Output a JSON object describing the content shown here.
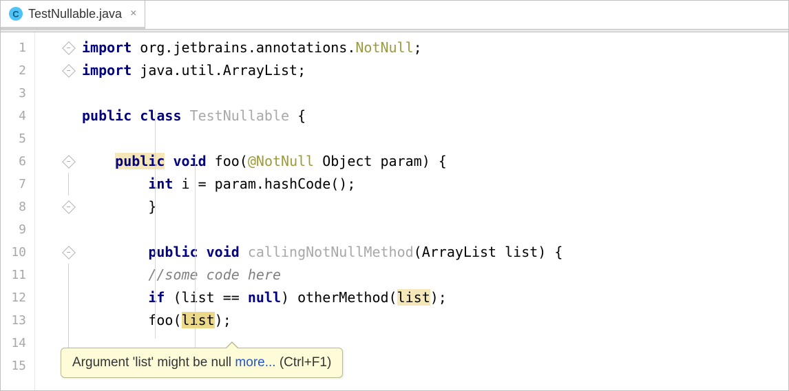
{
  "tab": {
    "icon_letter": "C",
    "filename": "TestNullable.java",
    "close_glyph": "×"
  },
  "gutter": {
    "line_numbers": [
      "1",
      "2",
      "3",
      "4",
      "5",
      "6",
      "7",
      "8",
      "9",
      "10",
      "11",
      "12",
      "13",
      "14",
      "15"
    ]
  },
  "code": {
    "l1": {
      "kw1": "import",
      "t1": " org.jetbrains.annotations.",
      "ann": "NotNull",
      "t2": ";"
    },
    "l2": {
      "kw1": "import",
      "t1": " java.util.ArrayList;"
    },
    "l4": {
      "kw1": "public",
      "sp": " ",
      "kw2": "class",
      "sp2": " ",
      "cls": "TestNullable",
      "t1": " {"
    },
    "l6": {
      "ind": "    ",
      "kw1": "public",
      "sp": " ",
      "kw2": "void",
      "t1": " foo(",
      "ann": "@NotNull",
      "t2": " Object param) {"
    },
    "l7": {
      "ind": "        ",
      "kw1": "int",
      "t1": " i = param.hashCode();"
    },
    "l8": {
      "ind": "        ",
      "t1": "}"
    },
    "l10": {
      "ind": "        ",
      "kw1": "public",
      "sp": " ",
      "kw2": "void",
      "sp2": " ",
      "cls": "callingNotNullMethod",
      "t1": "(ArrayList list) {"
    },
    "l11": {
      "ind": "        ",
      "cmt": "//some code here"
    },
    "l12": {
      "ind": "        ",
      "kw1": "if",
      "t1": " (list == ",
      "kw2": "null",
      "t2": ") otherMethod(",
      "hl": "list",
      "t3": ");"
    },
    "l13": {
      "ind": "        ",
      "t1": "foo(",
      "hl": "list",
      "t2": ");"
    }
  },
  "tooltip": {
    "message": "Argument 'list' might be null ",
    "link": "more...",
    "shortcut": " (Ctrl+F1)"
  }
}
